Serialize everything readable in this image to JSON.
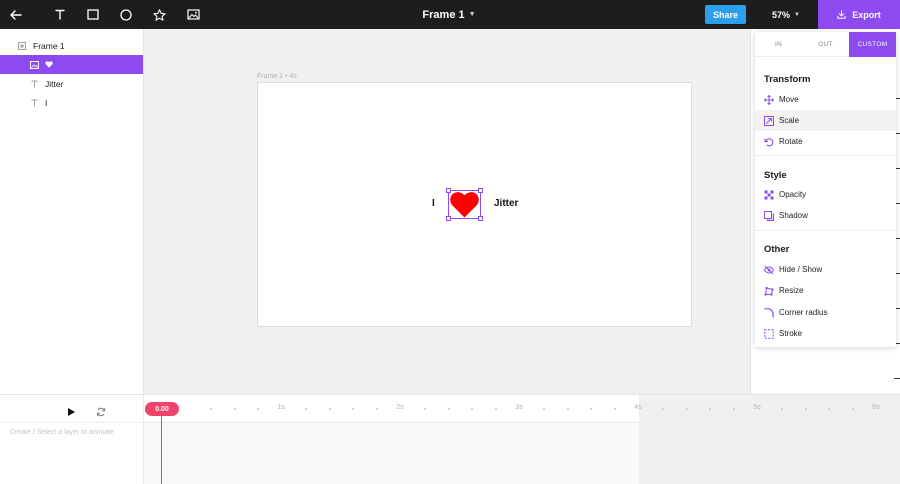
{
  "toolbar": {
    "title": "Frame 1",
    "share_label": "Share",
    "zoom": "57%",
    "export_label": "Export"
  },
  "layers": [
    {
      "name": "Frame 1",
      "icon": "frame-icon"
    },
    {
      "name": "",
      "icon": "image-icon",
      "extra_icon": "heart-icon"
    },
    {
      "name": "Jitter",
      "icon": "text-icon"
    },
    {
      "name": "I",
      "icon": "text-icon"
    }
  ],
  "canvas": {
    "frame_label": "Frame 1 • 4s",
    "text_i": "I",
    "text_jitter": "Jitter",
    "heart_color": "#ff0000"
  },
  "anim_menu": {
    "tabs": [
      "IN",
      "OUT",
      "CUSTOM"
    ],
    "active_tab": "CUSTOM",
    "sections": [
      {
        "title": "Transform",
        "items": [
          "Move",
          "Scale",
          "Rotate"
        ]
      },
      {
        "title": "Style",
        "items": [
          "Opacity",
          "Shadow"
        ]
      },
      {
        "title": "Other",
        "items": [
          "Hide / Show",
          "Resize",
          "Corner radius",
          "Stroke"
        ]
      }
    ]
  },
  "timeline": {
    "playhead": "0.00",
    "hint": "Create / Select a layer to animate",
    "ticks": [
      "1s",
      "2s",
      "3s",
      "4s",
      "5s",
      "6s"
    ]
  },
  "colors": {
    "accent": "#8c4af0",
    "share": "#2c9fec",
    "playhead": "#f0436b",
    "topbar": "#1d1d1f"
  }
}
